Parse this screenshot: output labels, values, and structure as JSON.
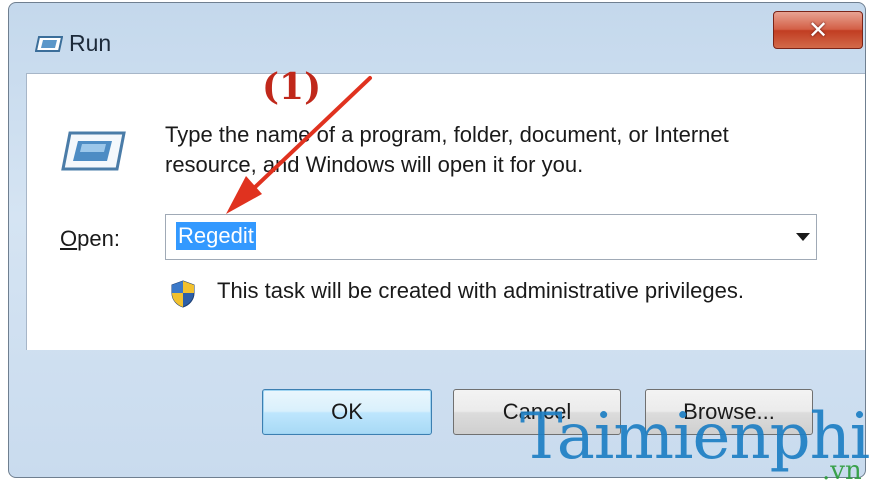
{
  "window": {
    "title": "Run"
  },
  "close_button": {
    "symbol": "✕"
  },
  "description": {
    "line1": "Type the name of a program, folder, document, or Internet",
    "line2": "resource, and Windows will open it for you."
  },
  "open_field": {
    "label_mnemonic": "O",
    "label_rest": "pen:",
    "value": "Regedit"
  },
  "admin_note": "This task will be created with administrative privileges.",
  "buttons": {
    "ok": "OK",
    "cancel": "Cancel",
    "browse": "Browse..."
  },
  "annotation": {
    "label": "(1)",
    "color": "#c0281b"
  },
  "watermark": {
    "text": "Taimienphi",
    "suffix": ".vn"
  },
  "icons": {
    "title": "run-icon",
    "dialog": "run-icon",
    "admin": "uac-shield-icon",
    "dropdown": "chevron-down-icon"
  },
  "colors": {
    "selection": "#3399ff",
    "window_frame": "#c9dbee",
    "close_button": "#c13d22"
  }
}
